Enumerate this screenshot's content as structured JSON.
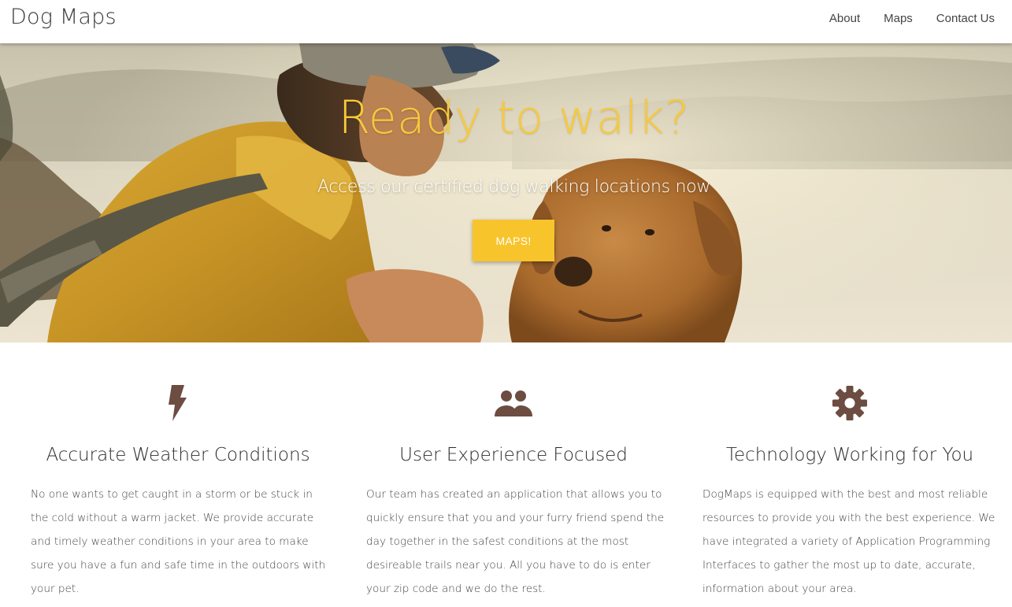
{
  "navbar": {
    "brand": "Dog Maps",
    "links": [
      "About",
      "Maps",
      "Contact Us"
    ]
  },
  "hero": {
    "title": "Ready to walk?",
    "subtitle": "Access our certified dog walking locations now",
    "button_label": "MAPS!"
  },
  "features": [
    {
      "icon": "lightning-bolt-icon",
      "title": "Accurate Weather Conditions",
      "text": "No one wants to get caught in a storm or be stuck in the cold without a warm jacket. We provide accurate and timely weather conditions in your area to make sure you have a fun and safe time in the outdoors with your pet."
    },
    {
      "icon": "people-icon",
      "title": "User Experience Focused",
      "text": "Our team has created an application that allows you to quickly ensure that you and your furry friend spend the day together in the safest conditions at the most desireable trails near you. All you have to do is enter your zip code and we do the rest."
    },
    {
      "icon": "gear-icon",
      "title": "Technology Working for You",
      "text": "DogMaps is equipped with the best and most reliable resources to provide you with the best experience. We have integrated a variety of Application Programming Interfaces to gather the most up to date, accurate, information about your area."
    }
  ],
  "colors": {
    "accent": "#f8c42c",
    "title": "#f8c93a",
    "icon": "#6d4c41"
  }
}
